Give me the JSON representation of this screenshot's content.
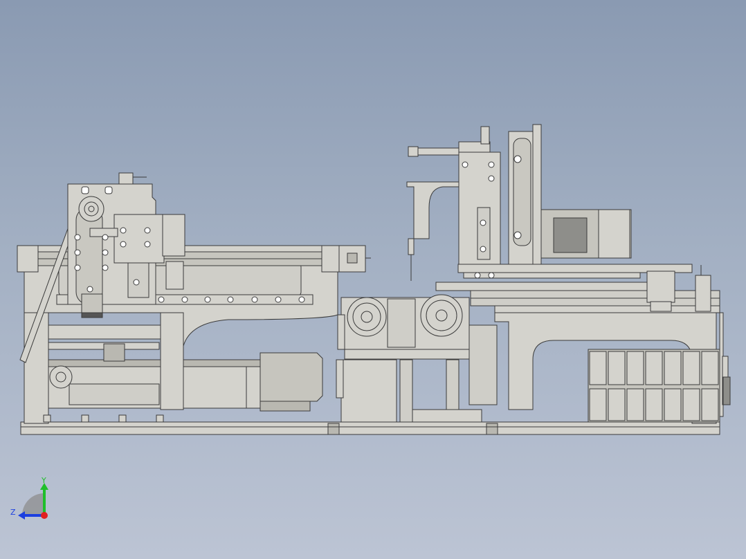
{
  "triad": {
    "y_label": "Y",
    "z_label": "Z",
    "colors": {
      "y": "#1fbf2a",
      "z": "#1c3fe0",
      "x": "#e02020"
    }
  },
  "colors": {
    "background_top": "#8a9ab2",
    "background_bottom": "#bcc4d4",
    "part_fill": "#d4d3cd",
    "part_shade": "#b9b8b1",
    "edge": "#3a3a3a",
    "motor_dark": "#8e8e8a"
  }
}
